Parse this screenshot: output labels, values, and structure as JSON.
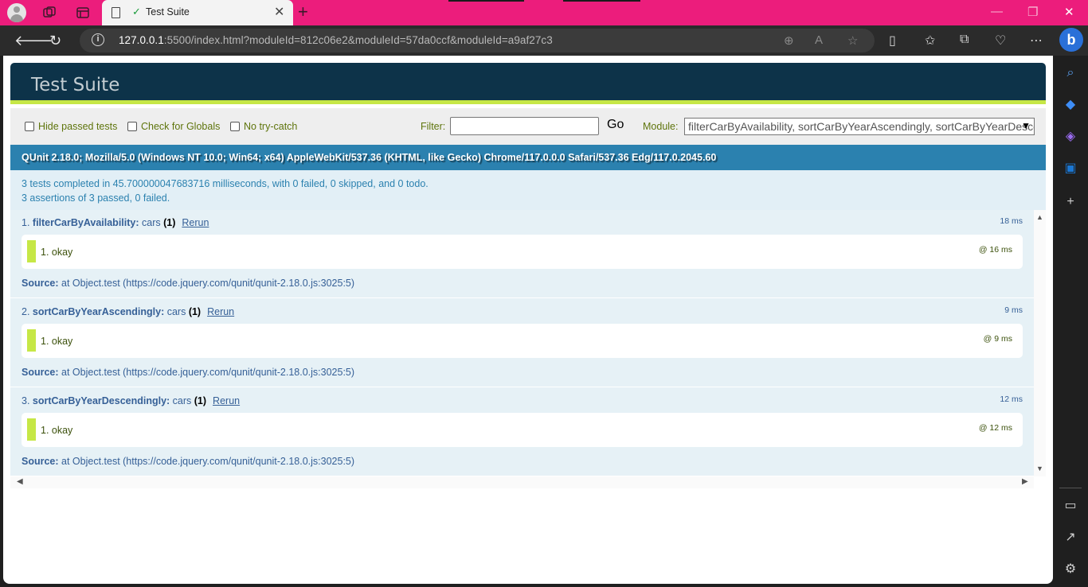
{
  "browser": {
    "tab_title": "Test Suite",
    "url_host": "127.0.0.1",
    "url_rest": ":5500/index.html?moduleId=812c06e2&moduleId=57da0ccf&moduleId=a9af27c3",
    "bing_label": "b"
  },
  "page": {
    "header": "Test Suite",
    "toolbar": {
      "hide_passed": "Hide passed tests",
      "check_globals": "Check for Globals",
      "no_try_catch": "No try-catch",
      "filter_label": "Filter:",
      "filter_value": "",
      "go": "Go",
      "module_label": "Module:",
      "module_value": "filterCarByAvailability, sortCarByYearAscendingly, sortCarByYearDescendingly"
    },
    "user_agent": "QUnit 2.18.0; Mozilla/5.0 (Windows NT 10.0; Win64; x64) AppleWebKit/537.36 (KHTML, like Gecko) Chrome/117.0.0.0 Safari/537.36 Edg/117.0.2045.60",
    "result_line1": "3 tests completed in 45.700000047683716 milliseconds, with 0 failed, 0 skipped, and 0 todo.",
    "result_line2": "3 assertions of 3 passed, 0 failed.",
    "tests": [
      {
        "prefix": "1. ",
        "name": "filterCarByAvailability:",
        "module": " cars ",
        "count": "(1)",
        "rerun": "Rerun",
        "runtime": "18 ms",
        "assertion": "1. okay",
        "assertion_time": "@ 16 ms",
        "source_label": "Source:",
        "source": " at Object.test (https://code.jquery.com/qunit/qunit-2.18.0.js:3025:5)"
      },
      {
        "prefix": "2. ",
        "name": "sortCarByYearAscendingly:",
        "module": " cars ",
        "count": "(1)",
        "rerun": "Rerun",
        "runtime": "9 ms",
        "assertion": "1. okay",
        "assertion_time": "@ 9 ms",
        "source_label": "Source:",
        "source": " at Object.test (https://code.jquery.com/qunit/qunit-2.18.0.js:3025:5)"
      },
      {
        "prefix": "3. ",
        "name": "sortCarByYearDescendingly:",
        "module": " cars ",
        "count": "(1)",
        "rerun": "Rerun",
        "runtime": "12 ms",
        "assertion": "1. okay",
        "assertion_time": "@ 12 ms",
        "source_label": "Source:",
        "source": " at Object.test (https://code.jquery.com/qunit/qunit-2.18.0.js:3025:5)"
      }
    ]
  },
  "colors": {
    "titlebar": "#ec1d7c",
    "qunit_header": "#0d3349",
    "qunit_pass": "#c6e746",
    "qunit_banner": "#2b81af"
  }
}
